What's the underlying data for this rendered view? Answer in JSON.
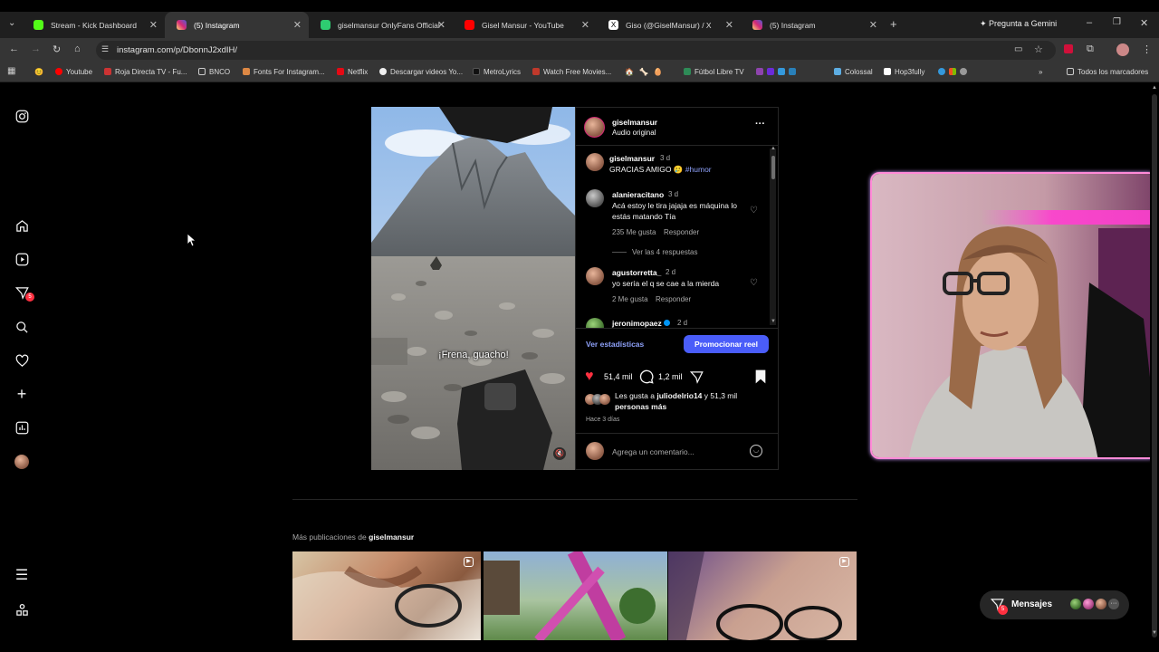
{
  "browser": {
    "tabs": [
      {
        "label": "Stream - Kick Dashboard",
        "color": "#53fc18"
      },
      {
        "label": "(5) Instagram",
        "color": "#e1306c"
      },
      {
        "label": "giselmansur OnlyFans Official -",
        "color": "#2ecc71"
      },
      {
        "label": "Gisel Mansur - YouTube",
        "color": "#ff0000"
      },
      {
        "label": "Giso (@GiselMansur) / X",
        "color": "#ffffff"
      },
      {
        "label": "(5) Instagram",
        "color": "#e1306c"
      }
    ],
    "gemini_label": "Pregunta a Gemini",
    "url": "instagram.com/p/DbonnJ2xdIH/",
    "bookmarks": [
      "Youtube",
      "Roja Directa TV - Fu...",
      "BNCO",
      "Fonts For Instagram...",
      "Netflix",
      "Descargar videos Yo...",
      "MetroLyrics",
      "Watch Free Movies...",
      "Fútbol Libre TV",
      "Colossal",
      "Hop3fully"
    ],
    "all_bookmarks": "Todos los marcadores"
  },
  "sidebar": {
    "notification_count": "5",
    "icons": [
      "instagram-icon",
      "home-icon",
      "reels-icon",
      "messages-icon",
      "search-icon",
      "heart-icon",
      "create-icon",
      "dashboard-icon",
      "profile-avatar",
      "menu-icon",
      "more-icon"
    ]
  },
  "post": {
    "username": "giselmansur",
    "audio": "Audio original",
    "caption_user": "giselmansur",
    "caption_time": "3 d",
    "caption_text": "GRACIAS AMIGO 🥲",
    "caption_tag": "#humor",
    "video_caption": "¡Frena, guacho!",
    "comments": [
      {
        "user": "alanieracitano",
        "time": "3 d",
        "text": "Acá estoy le tira jajaja es máquina lo estás matando Tía",
        "likes": "235 Me gusta",
        "reply": "Responder",
        "replies": "Ver las 4 respuestas"
      },
      {
        "user": "agustorretta_",
        "time": "2 d",
        "text": "yo sería el q se cae a la mierda",
        "likes": "2 Me gusta",
        "reply": "Responder"
      },
      {
        "user": "jeronimopaez",
        "time": "2 d"
      }
    ],
    "stats_link": "Ver estadísticas",
    "promote_button": "Promocionar reel",
    "likes_count": "51,4 mil",
    "comments_count": "1,2 mil",
    "liked_by_prefix": "Les gusta a",
    "liked_by_user": "juliodelrio14",
    "liked_by_suffix": "y 51,3 mil",
    "liked_by_more": "personas más",
    "posted": "Hace 3 días",
    "add_comment_placeholder": "Agrega un comentario..."
  },
  "more_posts": {
    "prefix": "Más publicaciones de",
    "user": "giselmansur"
  },
  "messages": {
    "label": "Mensajes",
    "badge": "5"
  }
}
